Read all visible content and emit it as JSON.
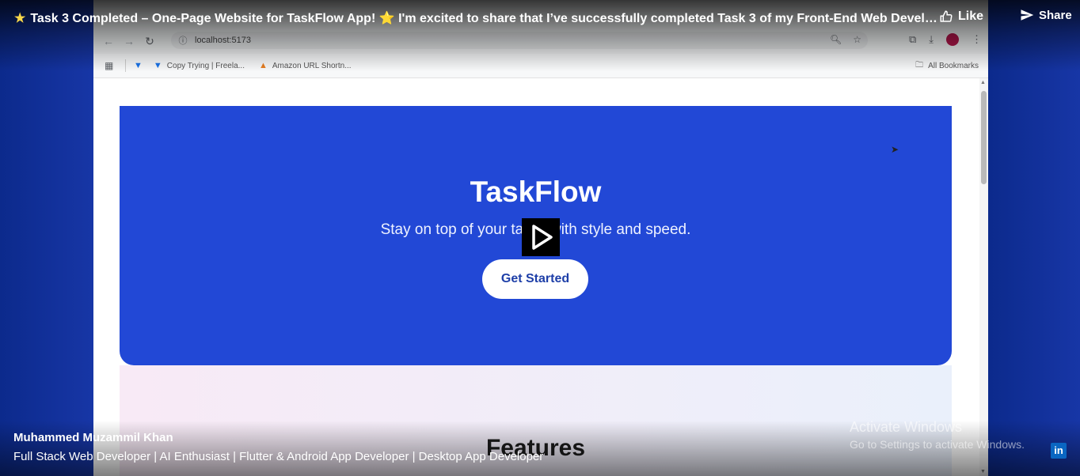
{
  "post": {
    "title": "Task 3 Completed – One-Page Website for TaskFlow App! ⭐ I'm excited to share that I’ve successfully completed Task 3 of my Front-End Web Development...",
    "like_label": "Like",
    "share_label": "Share"
  },
  "browser": {
    "address": "localhost:5173",
    "bookmarks": [
      {
        "label": "Copy Trying | Freela..."
      },
      {
        "label": "Amazon URL Shortn..."
      }
    ],
    "all_bookmarks": "All Bookmarks"
  },
  "site": {
    "hero_title": "TaskFlow",
    "hero_subtitle": "Stay on top of your tasks with style and speed.",
    "cta_label": "Get Started",
    "features_title": "Features",
    "hero_color": "#2248d6"
  },
  "author": {
    "name": "Muhammed Muzammil Khan",
    "headline": "Full Stack Web Developer | AI Enthusiast | Flutter & Android App Developer | Desktop App Developer"
  },
  "watermark": {
    "title": "Activate Windows",
    "subtitle": "Go to Settings to activate Windows."
  },
  "icons": {
    "star": "star-icon",
    "like": "thumbs-up-icon",
    "share": "send-icon",
    "play": "play-icon",
    "linkedin": "linkedin-icon"
  }
}
